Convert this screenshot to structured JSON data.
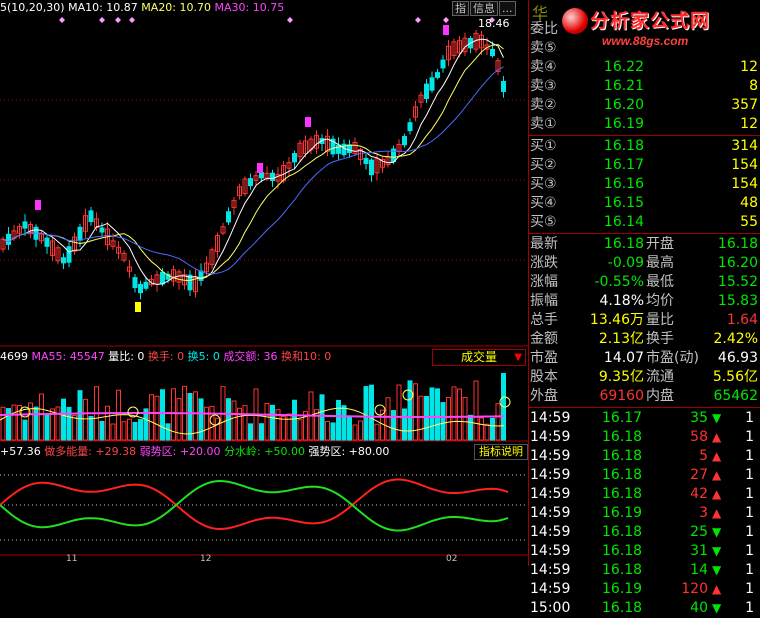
{
  "indicator_main": {
    "label": "5(10,20,30)",
    "ma10_label": "MA10: 10.87",
    "ma20_label": "MA20: 10.70",
    "ma30_label": "MA30: 10.75",
    "price_tag": "18.46"
  },
  "indicator_volume": {
    "v1": "4699",
    "ma55": "MA55: 45547",
    "ratio": "量比: 0",
    "huanshou": "换手: 0",
    "huan5": "换5: 0",
    "chengjiao": "成交额: 36",
    "huanhe": "换和10: 0",
    "dropdown": "成交量"
  },
  "indicator_third": {
    "a": "+57.36",
    "b": "做多能量: +29.38",
    "c": "弱势区: +20.00",
    "d": "分水岭: +50.00",
    "e": "强势区: +80.00",
    "help": "指标说明"
  },
  "x_axis": {
    "t1": "11",
    "t2": "12",
    "t3": "02"
  },
  "top_tabs": [
    "指",
    "信息",
    "..."
  ],
  "panel": {
    "name": "华",
    "logo_text": "分析家公式网",
    "logo_url": "www.88gs.com",
    "weibi_label": "委比",
    "sell": [
      {
        "label": "卖⑤",
        "price": "",
        "vol": ""
      },
      {
        "label": "卖④",
        "price": "16.22",
        "vol": "12"
      },
      {
        "label": "卖③",
        "price": "16.21",
        "vol": "8"
      },
      {
        "label": "卖②",
        "price": "16.20",
        "vol": "357"
      },
      {
        "label": "卖①",
        "price": "16.19",
        "vol": "12"
      }
    ],
    "buy": [
      {
        "label": "买①",
        "price": "16.18",
        "vol": "314"
      },
      {
        "label": "买②",
        "price": "16.17",
        "vol": "154"
      },
      {
        "label": "买③",
        "price": "16.16",
        "vol": "154"
      },
      {
        "label": "买④",
        "price": "16.15",
        "vol": "48"
      },
      {
        "label": "买⑤",
        "price": "16.14",
        "vol": "55"
      }
    ],
    "stats": [
      {
        "l1": "最新",
        "v1": "16.18",
        "l2": "开盘",
        "v2": "16.18",
        "c1": "green",
        "c2": "green"
      },
      {
        "l1": "涨跌",
        "v1": "-0.09",
        "l2": "最高",
        "v2": "16.20",
        "c1": "green",
        "c2": "green"
      },
      {
        "l1": "涨幅",
        "v1": "-0.55%",
        "l2": "最低",
        "v2": "15.52",
        "c1": "green",
        "c2": "green"
      },
      {
        "l1": "振幅",
        "v1": "4.18%",
        "l2": "均价",
        "v2": "15.83",
        "c1": "white",
        "c2": "green"
      },
      {
        "l1": "总手",
        "v1": "13.46万",
        "l2": "量比",
        "v2": "1.64",
        "c1": "yellow",
        "c2": "red"
      },
      {
        "l1": "金额",
        "v1": "2.13亿",
        "l2": "换手",
        "v2": "2.42%",
        "c1": "yellow",
        "c2": "yellow"
      },
      {
        "l1": "市盈",
        "v1": "14.07",
        "l2": "市盈(动)",
        "v2": "46.93",
        "c1": "white",
        "c2": "white"
      },
      {
        "l1": "股本",
        "v1": "9.35亿",
        "l2": "流通",
        "v2": "5.56亿",
        "c1": "yellow",
        "c2": "yellow"
      },
      {
        "l1": "外盘",
        "v1": "69160",
        "l2": "内盘",
        "v2": "65462",
        "c1": "red",
        "c2": "green"
      }
    ],
    "ticks": [
      {
        "t": "14:59",
        "p": "16.17",
        "v": "35",
        "dir": "down",
        "n": "1"
      },
      {
        "t": "14:59",
        "p": "16.18",
        "v": "58",
        "dir": "up",
        "n": "1"
      },
      {
        "t": "14:59",
        "p": "16.18",
        "v": "5",
        "dir": "up",
        "n": "1"
      },
      {
        "t": "14:59",
        "p": "16.18",
        "v": "27",
        "dir": "up",
        "n": "1"
      },
      {
        "t": "14:59",
        "p": "16.18",
        "v": "42",
        "dir": "up",
        "n": "1"
      },
      {
        "t": "14:59",
        "p": "16.19",
        "v": "3",
        "dir": "up",
        "n": "1"
      },
      {
        "t": "14:59",
        "p": "16.18",
        "v": "25",
        "dir": "down",
        "n": "1"
      },
      {
        "t": "14:59",
        "p": "16.18",
        "v": "31",
        "dir": "down",
        "n": "1"
      },
      {
        "t": "14:59",
        "p": "16.18",
        "v": "14",
        "dir": "down",
        "n": "1"
      },
      {
        "t": "14:59",
        "p": "16.19",
        "v": "120",
        "dir": "up",
        "n": "1"
      },
      {
        "t": "15:00",
        "p": "16.18",
        "v": "40",
        "dir": "down",
        "n": "1"
      }
    ]
  },
  "colors": {
    "up": "#ff3232",
    "down": "#00e6e6",
    "ma_white": "#ffffff",
    "ma_yellow": "#ffff66",
    "ma_blue": "#4a6bff",
    "grid": "#a00000"
  }
}
